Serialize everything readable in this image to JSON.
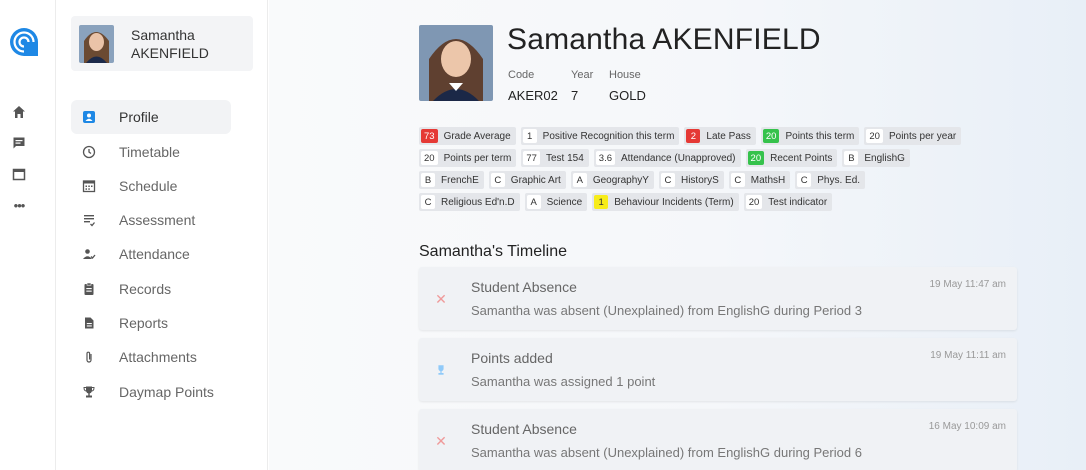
{
  "colors": {
    "accent": "#1e88e5",
    "badge_red": "#e53935",
    "badge_green": "#35c24c",
    "badge_yellow": "#f7ec1a",
    "absence_icon": "#ef9a9a",
    "points_icon": "#90caf9"
  },
  "rail": {
    "logo": "daymap-logo-icon",
    "icons": [
      "home-icon",
      "message-icon",
      "calendar-icon",
      "more-icon"
    ]
  },
  "user": {
    "first_name": "Samantha",
    "last_name": "AKENFIELD"
  },
  "sidebar": {
    "items": [
      {
        "label": "Profile",
        "icon": "profile-icon",
        "active": true
      },
      {
        "label": "Timetable",
        "icon": "clock-icon"
      },
      {
        "label": "Schedule",
        "icon": "calendar-grid-icon"
      },
      {
        "label": "Assessment",
        "icon": "assessment-icon"
      },
      {
        "label": "Attendance",
        "icon": "attendance-icon"
      },
      {
        "label": "Records",
        "icon": "clipboard-icon"
      },
      {
        "label": "Reports",
        "icon": "document-icon"
      },
      {
        "label": "Attachments",
        "icon": "paperclip-icon"
      },
      {
        "label": "Daymap Points",
        "icon": "trophy-icon"
      }
    ]
  },
  "profile": {
    "name": "Samantha AKENFIELD",
    "code_label": "Code",
    "code": "AKER02",
    "year_label": "Year",
    "year": "7",
    "house_label": "House",
    "house": "GOLD"
  },
  "badges": {
    "row1": [
      {
        "value": "73",
        "label": "Grade Average",
        "style": "red"
      },
      {
        "value": "1",
        "label": "Positive Recognition this term",
        "style": "white"
      },
      {
        "value": "2",
        "label": "Late Pass",
        "style": "red"
      },
      {
        "value": "20",
        "label": "Points this term",
        "style": "green"
      },
      {
        "value": "20",
        "label": "Points per year",
        "style": "white"
      }
    ],
    "row2": [
      {
        "value": "20",
        "label": "Points per term",
        "style": "white"
      },
      {
        "value": "77",
        "label": "Test 154",
        "style": "white"
      },
      {
        "value": "3.6",
        "label": "Attendance (Unapproved)",
        "style": "white"
      },
      {
        "value": "20",
        "label": "Recent Points",
        "style": "green"
      },
      {
        "value": "B",
        "label": "EnglishG",
        "style": "white"
      }
    ],
    "row3": [
      {
        "value": "B",
        "label": "FrenchE",
        "style": "white"
      },
      {
        "value": "C",
        "label": "Graphic Art",
        "style": "white"
      },
      {
        "value": "A",
        "label": "GeographyY",
        "style": "white"
      },
      {
        "value": "C",
        "label": "HistoryS",
        "style": "white"
      },
      {
        "value": "C",
        "label": "MathsH",
        "style": "white"
      },
      {
        "value": "C",
        "label": "Phys. Ed.",
        "style": "white"
      }
    ],
    "row4": [
      {
        "value": "C",
        "label": "Religious Ed'n.D",
        "style": "white"
      },
      {
        "value": "A",
        "label": "Science",
        "style": "white"
      },
      {
        "value": "1",
        "label": "Behaviour Incidents (Term)",
        "style": "yellow"
      },
      {
        "value": "20",
        "label": "Test indicator",
        "style": "white"
      }
    ]
  },
  "timeline": {
    "title": "Samantha's Timeline",
    "items": [
      {
        "icon": "close-icon",
        "title": "Student Absence",
        "body": "Samantha was absent (Unexplained) from EnglishG during Period 3",
        "time": "19 May 11:47 am"
      },
      {
        "icon": "trophy-icon",
        "title": "Points added",
        "body": "Samantha was assigned 1 point",
        "time": "19 May 11:11 am"
      },
      {
        "icon": "close-icon",
        "title": "Student Absence",
        "body": "Samantha was absent (Unexplained) from EnglishG during Period 6",
        "time": "16 May 10:09 am"
      }
    ]
  }
}
